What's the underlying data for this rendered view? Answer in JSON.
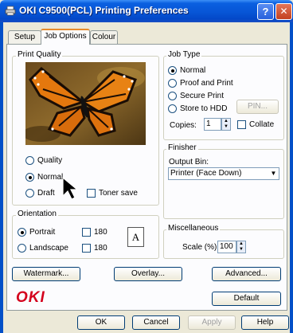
{
  "window": {
    "title": "OKI C9500(PCL) Printing Preferences",
    "help_label": "?",
    "close_label": "✕"
  },
  "tabs": [
    {
      "label": "Setup"
    },
    {
      "label": "Job Options"
    },
    {
      "label": "Colour"
    }
  ],
  "print_quality": {
    "group_label": "Print Quality",
    "options": [
      {
        "label": "Quality",
        "selected": false
      },
      {
        "label": "Normal",
        "selected": true
      },
      {
        "label": "Draft",
        "selected": false
      }
    ],
    "toner_save_label": "Toner save"
  },
  "job_type": {
    "group_label": "Job Type",
    "options": [
      {
        "label": "Normal",
        "selected": true
      },
      {
        "label": "Proof and Print",
        "selected": false
      },
      {
        "label": "Secure Print",
        "selected": false
      },
      {
        "label": "Store to HDD",
        "selected": false
      }
    ],
    "pin_label": "PIN...",
    "copies_label": "Copies:",
    "copies_value": "1",
    "collate_label": "Collate"
  },
  "finisher": {
    "group_label": "Finisher",
    "output_bin_label": "Output Bin:",
    "output_bin_value": "Printer (Face Down)"
  },
  "orientation": {
    "group_label": "Orientation",
    "portrait_label": "Portrait",
    "landscape_label": "Landscape",
    "rotate_label_1": "180",
    "rotate_label_2": "180",
    "preview_letter": "A"
  },
  "miscellaneous": {
    "group_label": "Miscellaneous",
    "scale_label": "Scale (%):",
    "scale_value": "100"
  },
  "buttons": {
    "watermark": "Watermark...",
    "overlay": "Overlay...",
    "advanced": "Advanced...",
    "default": "Default",
    "ok": "OK",
    "cancel": "Cancel",
    "apply": "Apply",
    "help": "Help"
  },
  "brand": {
    "logo_text": "OKI",
    "logo_color": "#d4001c"
  },
  "colors": {
    "accent": "#0755d6",
    "tab_highlight": "#e68b2c"
  }
}
